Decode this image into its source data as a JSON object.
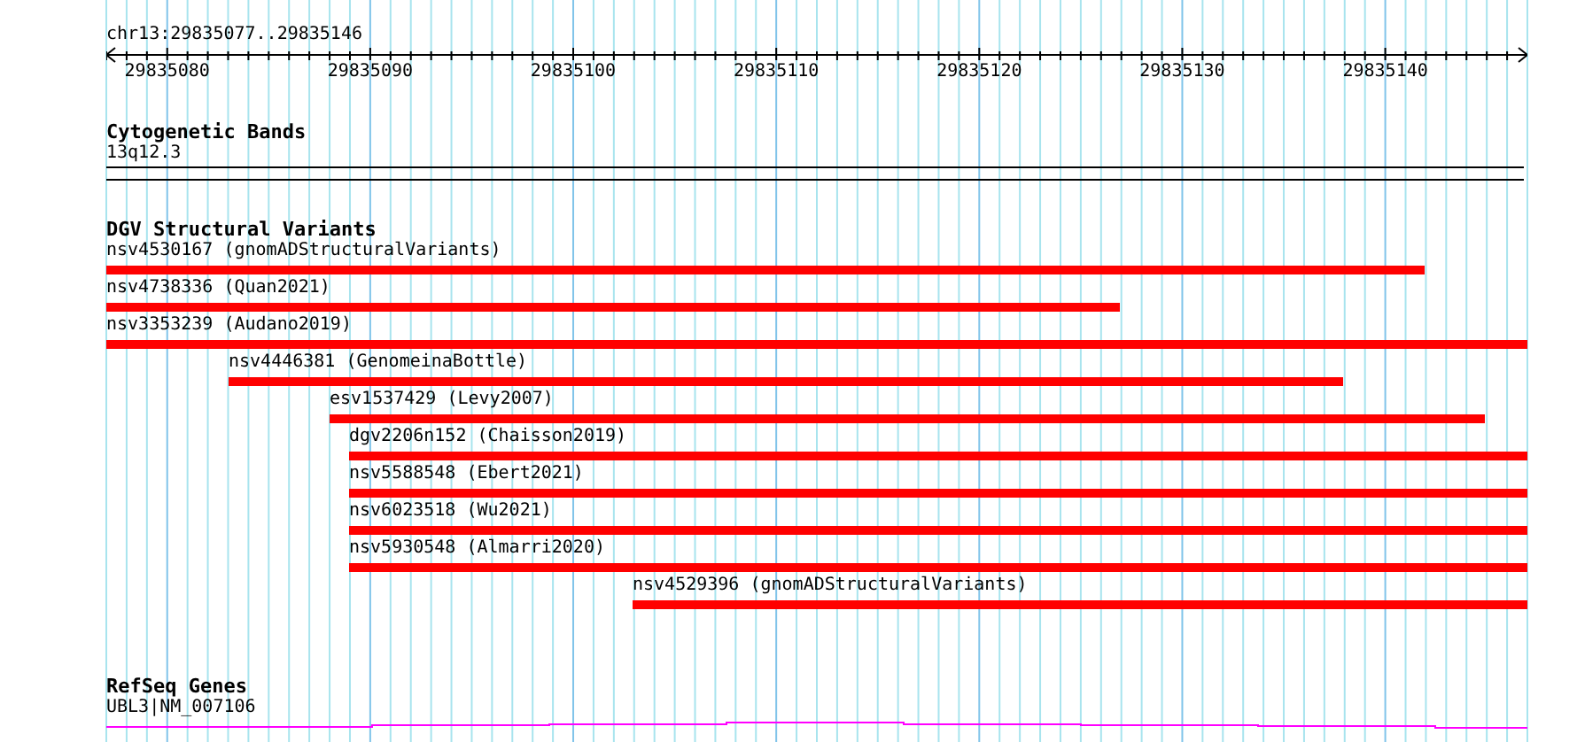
{
  "ruler": {
    "location": "chr13:29835077..29835146",
    "tick_labels": [
      "29835080",
      "29835090",
      "29835100",
      "29835110",
      "29835120",
      "29835130",
      "29835140"
    ]
  },
  "tracks": [
    {
      "kind": "cytoband",
      "title": "Cytogenetic Bands",
      "features": [
        {
          "label": "13q12.3"
        }
      ]
    },
    {
      "kind": "variants",
      "title": "DGV Structural Variants",
      "features": [
        {
          "label": "nsv4530167 (gnomADStructuralVariants)"
        },
        {
          "label": "nsv4738336 (Quan2021)"
        },
        {
          "label": "nsv3353239 (Audano2019)"
        },
        {
          "label": "nsv4446381 (GenomeinaBottle)"
        },
        {
          "label": "esv1537429 (Levy2007)"
        },
        {
          "label": "dgv2206n152 (Chaisson2019)"
        },
        {
          "label": "nsv5588548 (Ebert2021)"
        },
        {
          "label": "nsv6023518 (Wu2021)"
        },
        {
          "label": "nsv5930548 (Almarri2020)"
        },
        {
          "label": "nsv4529396 (gnomADStructuralVariants)"
        }
      ]
    },
    {
      "kind": "gene",
      "title": "RefSeq Genes",
      "features": [
        {
          "label": "UBL3|NM_007106"
        }
      ]
    }
  ]
}
